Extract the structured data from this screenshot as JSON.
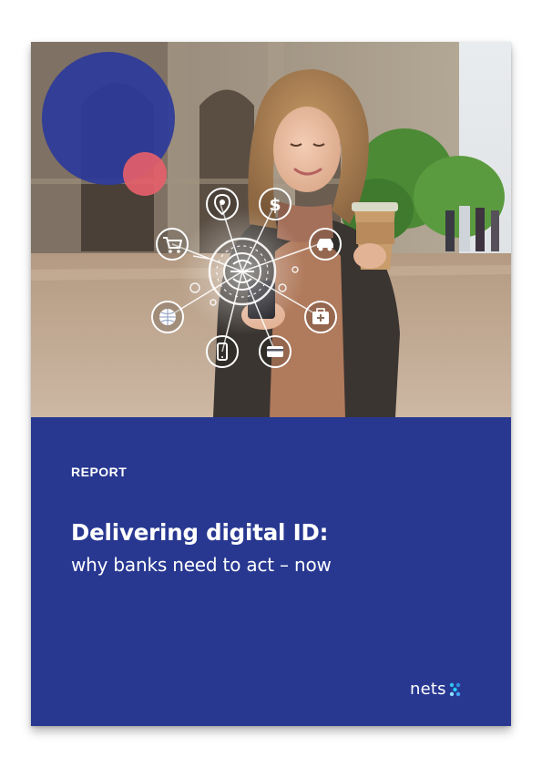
{
  "cover": {
    "label": "REPORT",
    "title": "Delivering digital ID:",
    "subtitle": "why banks need to act – now",
    "logo_text": "nets",
    "logo_dot_colors": [
      "#2ec3f0",
      "#2f8fe0",
      "#1fd0ff",
      "#42a5f5",
      "#8fe2ff"
    ]
  },
  "colors": {
    "panel": "#283891",
    "accent_circle_blue": "#2c3a9a",
    "accent_circle_coral": "#e5606a"
  },
  "icons": [
    "location-pin-icon",
    "dollar-icon",
    "shopping-cart-icon",
    "car-icon",
    "fingerprint-id-icon",
    "globe-icon",
    "medical-kit-icon",
    "smartphone-icon",
    "credit-card-icon"
  ]
}
